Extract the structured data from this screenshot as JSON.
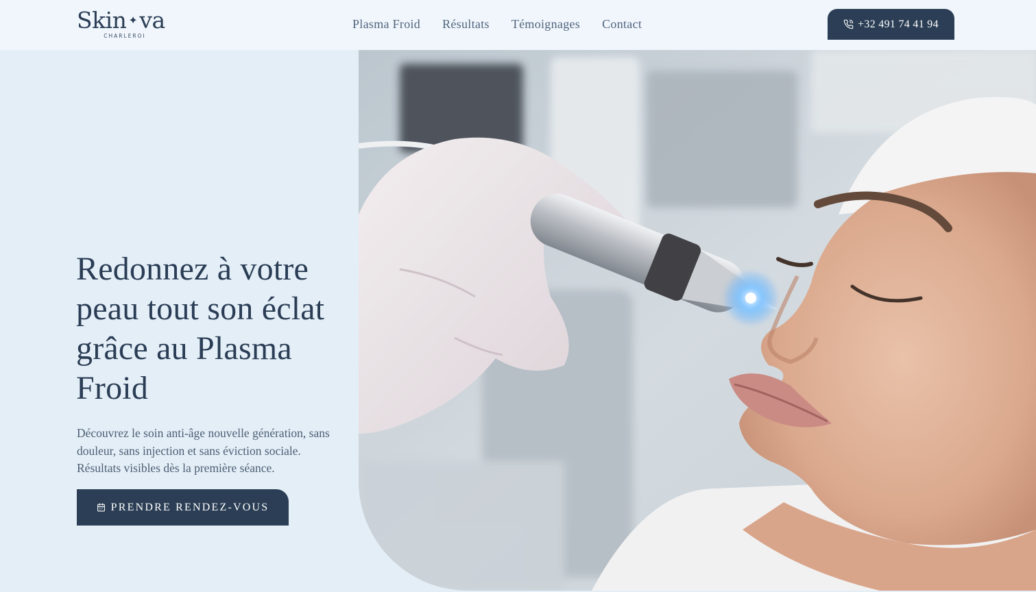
{
  "brand": {
    "name_start": "Skin",
    "name_end": "va",
    "city": "CHARLEROI"
  },
  "nav": {
    "items": [
      {
        "label": "Plasma Froid"
      },
      {
        "label": "Résultats"
      },
      {
        "label": "Témoignages"
      },
      {
        "label": "Contact"
      }
    ]
  },
  "header": {
    "phone": "+32 491 74 41 94",
    "phone_icon": "phone-icon"
  },
  "hero": {
    "title": "Redonnez à votre peau tout son éclat grâce au Plasma Froid",
    "subtitle": "Découvrez le soin anti-âge nouvelle génération, sans douleur, sans injection et sans éviction sociale. Résultats visibles dès la première séance.",
    "cta_label": "PRENDRE RENDEZ-VOUS",
    "cta_icon": "calendar-icon"
  },
  "colors": {
    "primary": "#2b3e55",
    "background": "#e4eef7",
    "header_bg": "#f0f6fc"
  }
}
